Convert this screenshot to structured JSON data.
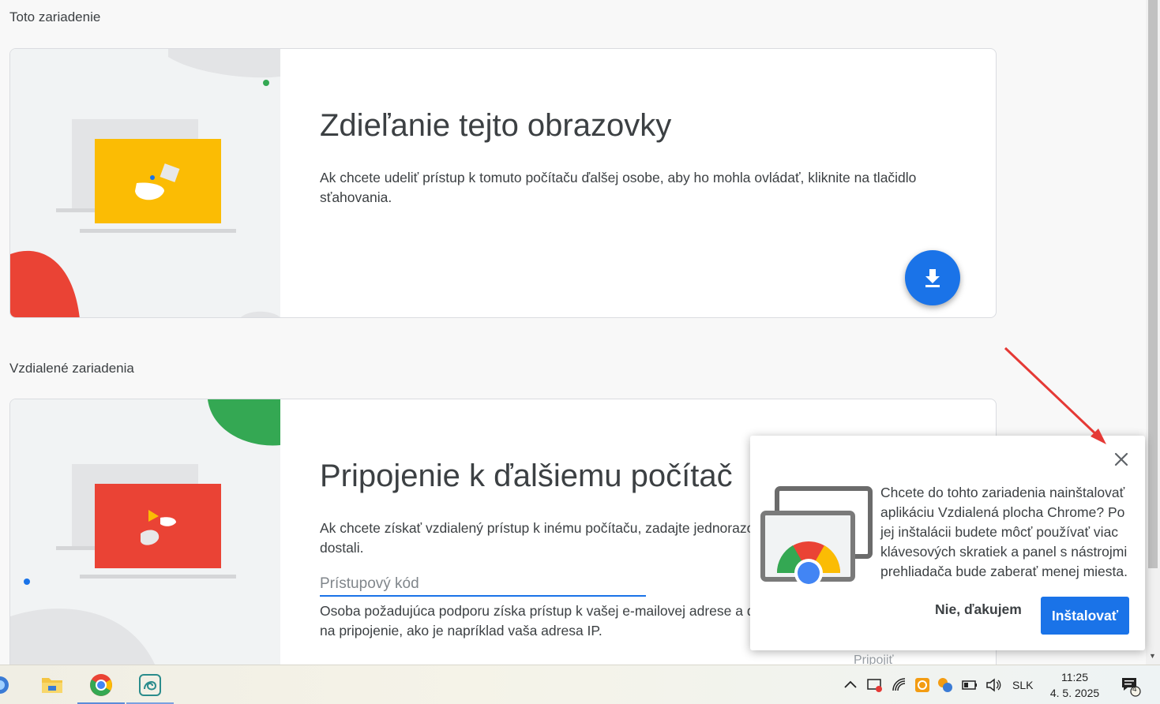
{
  "sections": {
    "this_device": "Toto zariadenie",
    "remote_devices": "Vzdialené zariadenia"
  },
  "share_card": {
    "title": "Zdieľanie tejto obrazovky",
    "description": "Ak chcete udeliť prístup k tomuto počítaču ďalšej osobe, aby ho mohla ovládať, kliknite na tlačidlo sťahovania."
  },
  "connect_card": {
    "title": "Pripojenie k ďalšiemu počítač",
    "description": "Ak chcete získať vzdialený prístup k inému počítaču, zadajte jednorazo",
    "description_2": "dostali.",
    "access_code_placeholder": "Prístupový kód",
    "note": "Osoba požadujúca podporu získa prístup k vašej e-mailovej adrese a ď",
    "note_2": "na pripojenie, ako je napríklad vaša adresa IP.",
    "connect_label": "Pripojiť"
  },
  "install_popup": {
    "message": "Chcete do tohto zariadenia nainštalovať aplikáciu Vzdialená plocha Chrome? Po jej inštalácii budete môcť používať viac klávesových skratiek a panel s nástrojmi prehliadača bude zaberať menej miesta.",
    "decline_label": "Nie, ďakujem",
    "install_label": "Inštalovať"
  },
  "taskbar": {
    "language": "SLK",
    "time": "11:25",
    "date": "4. 5. 2025",
    "notification_count": "4"
  },
  "colors": {
    "accent": "#1a73e8",
    "yellow": "#fbbc04",
    "red": "#ea4335",
    "green": "#34a853",
    "annotation_arrow": "#e53935"
  }
}
